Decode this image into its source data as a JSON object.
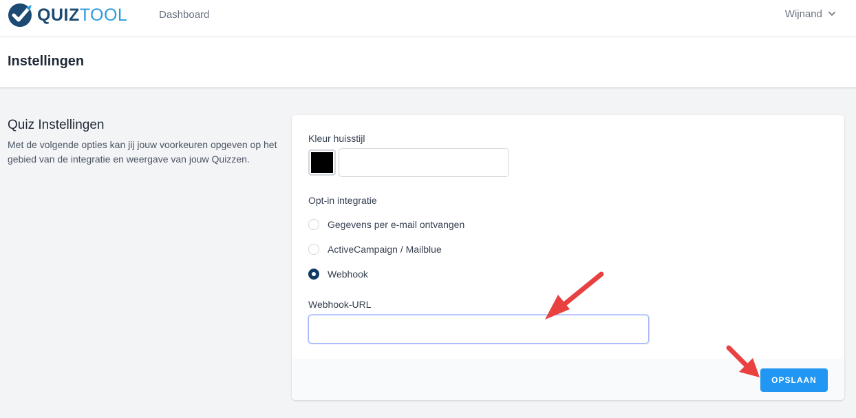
{
  "nav": {
    "logo_part1": "QUIZ",
    "logo_part2": "TOOL",
    "dashboard_link": "Dashboard",
    "user_name": "Wijnand"
  },
  "page": {
    "title": "Instellingen"
  },
  "section": {
    "title": "Quiz Instellingen",
    "description": "Met de volgende opties kan jij jouw voorkeuren opgeven op het gebied van de integratie en weergave van jouw Quizzen."
  },
  "form": {
    "color_label": "Kleur huisstijl",
    "color_value": "",
    "color_swatch": "#000000",
    "optin_label": "Opt-in integratie",
    "optin_options": [
      {
        "label": "Gegevens per e-mail ontvangen",
        "selected": false
      },
      {
        "label": "ActiveCampaign / Mailblue",
        "selected": false
      },
      {
        "label": "Webhook",
        "selected": true
      }
    ],
    "webhook_label": "Webhook-URL",
    "webhook_value": "",
    "save_label": "OPSLAAN"
  },
  "colors": {
    "brand_dark": "#1c4a73",
    "brand_light": "#2e9ad9",
    "primary_button": "#2196f3",
    "radio_checked": "#0f3a63",
    "annotation_arrow": "#e94040"
  },
  "icons": [
    "quiztool-logo-icon",
    "chevron-down-icon",
    "annotation-arrow-icon"
  ]
}
